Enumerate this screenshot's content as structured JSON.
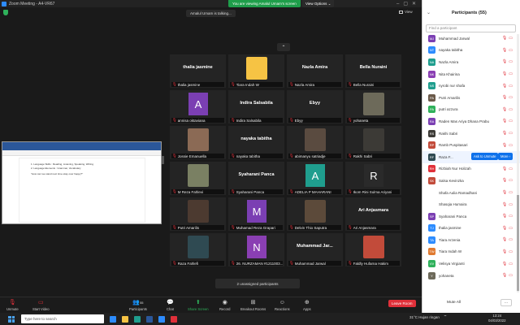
{
  "window": {
    "title": "Zoom Meeting - A4-VR67"
  },
  "banner": {
    "sharing_text": "You are viewing Amalul Umam's screen",
    "view_options": "View Options ⌄"
  },
  "meeting": {
    "talking": "Amalul Umam is talking...",
    "view_label": "View",
    "unassigned": "2 unassigned participants"
  },
  "shared_doc": {
    "lines": [
      "1.   Language Skills          : Reading, Listening, Speaking, Writing",
      "2.   Language Elements       : Grammar, Vocabulary",
      "\"How can we stand next time okay over happy?\""
    ]
  },
  "tiles": [
    {
      "label": "thalia jasmine",
      "big": "thalia jasmine",
      "type": "name"
    },
    {
      "label": "Tiara Indah W",
      "big": "",
      "type": "color",
      "color": "#f6c344"
    },
    {
      "label": "Nazla Amira",
      "big": "Nazla Amira",
      "type": "name"
    },
    {
      "label": "Bella Nuraini",
      "big": "Bella Nuraini",
      "type": "name"
    },
    {
      "label": "annisa oktaviana",
      "big": "A",
      "type": "letter",
      "color": "#7b3fb3"
    },
    {
      "label": "Indira Salsabila",
      "big": "Indira Salsabila",
      "type": "name"
    },
    {
      "label": "Ebyy",
      "big": "Ebyy",
      "type": "name"
    },
    {
      "label": "yohaneta",
      "big": "",
      "type": "photo",
      "color": "#6d6a5a"
    },
    {
      "label": "Jossie Emanuella",
      "big": "",
      "type": "photo",
      "color": "#8b6a55"
    },
    {
      "label": "nayaka tabitha",
      "big": "nayaka tabitha",
      "type": "name"
    },
    {
      "label": "abimanyu satriadje",
      "big": "",
      "type": "photo",
      "color": "#5a4b40"
    },
    {
      "label": "Rakhi Sabri",
      "big": "",
      "type": "photo",
      "color": "#3c3a36"
    },
    {
      "label": "M Reza Fahlevi",
      "big": "",
      "type": "photo",
      "color": "#7a8063"
    },
    {
      "label": "Syaharani Panca",
      "big": "Syaharani Panca",
      "type": "name"
    },
    {
      "label": "ADELIA P MAHARANI",
      "big": "A",
      "type": "letter",
      "color": "#1f9e8e"
    },
    {
      "label": "Ikom Rini Sulma Ariyani",
      "big": "R",
      "type": "letter",
      "color": "#2a2a2a"
    },
    {
      "label": "Putri Amarilis",
      "big": "",
      "type": "photo",
      "color": "#4c3a30"
    },
    {
      "label": "Muhamad Reza Grapari",
      "big": "M",
      "type": "letter",
      "color": "#7b3fb3"
    },
    {
      "label": "Delvin Thio Saputra",
      "big": "",
      "type": "photo",
      "color": "#5c4a3a"
    },
    {
      "label": "Ari Anjasmara",
      "big": "Ari Anjasmara",
      "type": "name"
    },
    {
      "label": "Raza Fahlefi",
      "big": "",
      "type": "photo",
      "color": "#2f4a52"
    },
    {
      "label": "26. NURZAMAN #1211003...",
      "big": "N",
      "type": "letter",
      "color": "#8a3fb3"
    },
    {
      "label": "Muhammad Jarwal",
      "big": "Muhammad Jar...",
      "type": "name"
    },
    {
      "label": "Faldly Hufarna Hakim",
      "big": "",
      "type": "photo",
      "color": "#c24b3a"
    }
  ],
  "toolbar": {
    "unmute": "Unmute",
    "start_video": "Start Video",
    "participants": "Participants",
    "participants_count": "55",
    "chat": "Chat",
    "share_screen": "Share Screen",
    "record": "Record",
    "breakout": "Breakout Rooms",
    "reactions": "Reactions",
    "apps": "Apps",
    "leave": "Leave Room"
  },
  "panel": {
    "title": "Participants (55)",
    "search_placeholder": "Find a participant",
    "ask_unmute": "Ask to Unmute",
    "more": "More ›",
    "mute_all": "Mute All",
    "dots": "...",
    "participants": [
      {
        "initials": "MJ",
        "name": "Muhammad Jarwal",
        "color": "#7b3fb3"
      },
      {
        "initials": "NT",
        "name": "nayaka tabitha",
        "color": "#2d8cff"
      },
      {
        "initials": "NA",
        "name": "Nazla Amira",
        "color": "#1f9e8e"
      },
      {
        "initials": "NK",
        "name": "Nita Khairina",
        "color": "#8a3fb3"
      },
      {
        "initials": "NS",
        "name": "nyrobi nur shafa",
        "color": "#1f9e8e"
      },
      {
        "initials": "PA",
        "name": "Putri Amarilis",
        "color": "#6b5a4a"
      },
      {
        "initials": "PA",
        "name": "putri azzura",
        "color": "#2fb15b"
      },
      {
        "initials": "RA",
        "name": "Raden Mas Ariya Dhana Prabu",
        "color": "#7b3fb3"
      },
      {
        "initials": "RS",
        "name": "Rakhi Sabri",
        "color": "#3c3a36"
      },
      {
        "initials": "RP",
        "name": "Ramb Puspitasari",
        "color": "#c24b3a"
      },
      {
        "initials": "RF",
        "name": "Raza F...",
        "color": "#2f4a52"
      },
      {
        "initials": "RH",
        "name": "Rizbiah Nur Holizah",
        "color": "#e0303a"
      },
      {
        "initials": "SK",
        "name": "Salsa Kevinzka",
        "color": "#c24b3a"
      },
      {
        "initials": "SR",
        "name": "Shafa Aulia Ramadhani",
        "color": "#ffffff"
      },
      {
        "initials": "SH",
        "name": "Shasqia Humaira",
        "color": "#ffffff"
      },
      {
        "initials": "SP",
        "name": "Syaharani Panca",
        "color": "#7b3fb3"
      },
      {
        "initials": "TJ",
        "name": "thalia jasmine",
        "color": "#2d8cff"
      },
      {
        "initials": "TA",
        "name": "Tiara Arzenia",
        "color": "#2d8cff"
      },
      {
        "initials": "TW",
        "name": "Tiara Indah W",
        "color": "#e07a30"
      },
      {
        "initials": "VV",
        "name": "Velisya Virgianti",
        "color": "#2fb15b"
      },
      {
        "initials": "Y",
        "name": "yohaneta",
        "color": "#6d6a5a"
      }
    ]
  },
  "taskbar": {
    "search_placeholder": "Type here to search",
    "weather": "31°C  Hujan ringan",
    "time": "13:24",
    "date": "04/03/2022"
  }
}
